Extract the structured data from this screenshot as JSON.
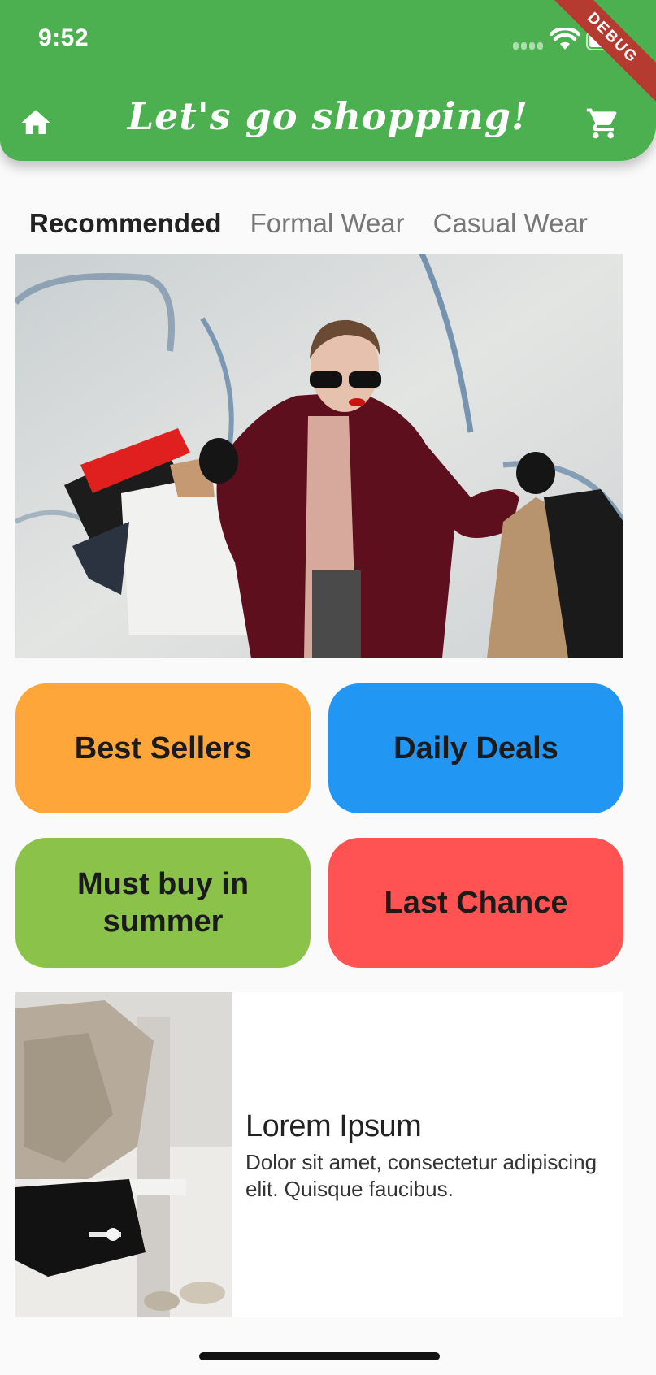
{
  "status_bar": {
    "time": "9:52"
  },
  "app_bar": {
    "title": "Let's go shopping!",
    "debug_label": "DEBUG",
    "home_icon": "home-icon",
    "cart_icon": "cart-icon"
  },
  "tabs": [
    {
      "label": "Recommended",
      "active": true
    },
    {
      "label": "Formal Wear",
      "active": false
    },
    {
      "label": "Casual Wear",
      "active": false
    }
  ],
  "categories": [
    {
      "label": "Best Sellers",
      "color": "#ffa63a"
    },
    {
      "label": "Daily Deals",
      "color": "#2196f3"
    },
    {
      "label": "Must buy in summer",
      "color": "#8bc34a"
    },
    {
      "label": "Last Chance",
      "color": "#ff5252"
    }
  ],
  "product_card": {
    "title": "Lorem Ipsum",
    "description": "Dolor sit amet, consectetur adipiscing elit. Quisque faucibus."
  },
  "colors": {
    "app_bar": "#4caf50",
    "background": "#fafafa"
  }
}
